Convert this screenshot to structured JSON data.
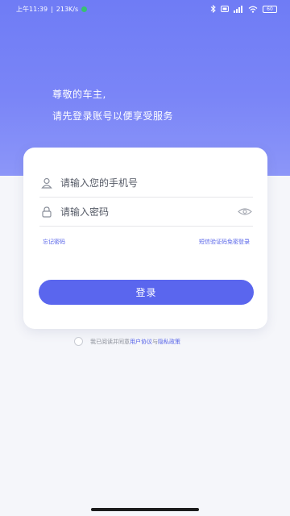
{
  "status_bar": {
    "time": "上午11:39",
    "speed": "213K/s",
    "battery": "60"
  },
  "header": {
    "greeting_line1": "尊敬的车主,",
    "greeting_line2": "请先登录账号以便享受服务"
  },
  "form": {
    "phone_placeholder": "请输入您的手机号",
    "password_placeholder": "请输入密码",
    "forgot_password": "忘记密码",
    "sms_login": "短信验证码免密登录",
    "login_button": "登录"
  },
  "agreement": {
    "prefix": "我已阅读并同意",
    "user_agreement": "用户协议",
    "and": "与",
    "privacy_policy": "隐私政策"
  },
  "icons": {
    "user": "user-icon",
    "lock": "lock-icon",
    "eye": "eye-icon"
  },
  "colors": {
    "primary": "#5a66ee",
    "hero": "#7a85f7",
    "background": "#f5f6fa"
  }
}
